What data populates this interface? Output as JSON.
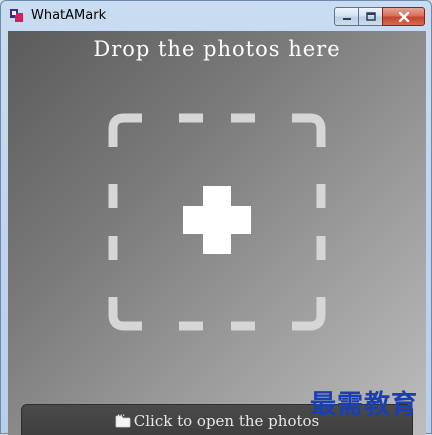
{
  "window": {
    "title": "WhatAMark",
    "app_icon": "whatamark-app-icon",
    "buttons": {
      "minimize": "minimize-icon",
      "maximize": "maximize-icon",
      "close": "close-icon"
    }
  },
  "drop_area": {
    "title": "Drop the photos here",
    "icon": "add-plus-icon",
    "frame": "dashed-rounded-square"
  },
  "open_bar": {
    "icon": "folder-open-icon",
    "label": "Click to open the photos"
  },
  "watermark": {
    "text": "最需教育"
  },
  "colors": {
    "title_bar": "#c9dcf1",
    "close_button": "#c4452c",
    "dash_frame": "#d6d6d6",
    "plus": "#ffffff",
    "watermark": "#1a3fb0"
  }
}
